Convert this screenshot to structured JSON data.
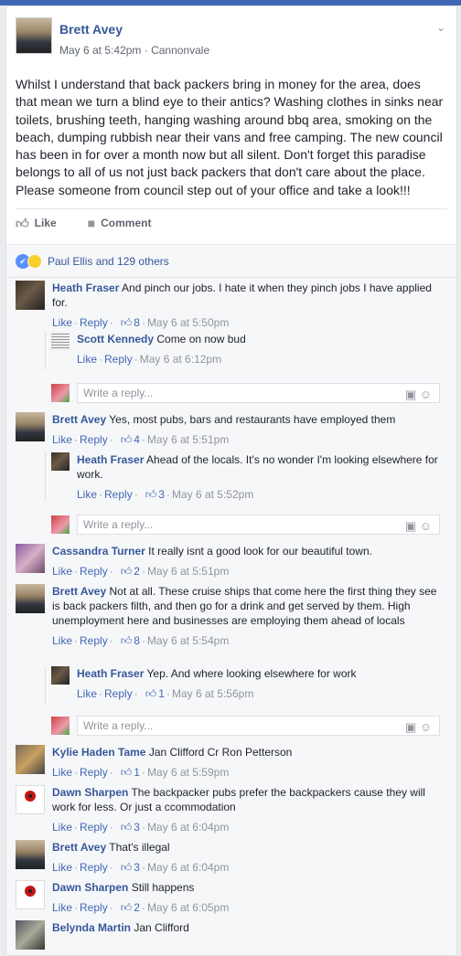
{
  "post": {
    "author": "Brett Avey",
    "date": "May 6 at 5:42pm",
    "sep": " · ",
    "location": "Cannonvale",
    "text": "Whilst I understand that back packers bring in money for the area, does that mean we turn a blind eye to their antics? Washing clothes in sinks near toilets, brushing teeth, hanging washing around bbq area, smoking on the beach, dumping rubbish near their vans and free camping. The new council has been in for over a month now but all silent. Don't forget this paradise belongs to all of us not just back packers that don't care about the place. Please someone from council step out of your office and take a look!!!",
    "like_label": "Like",
    "comment_label": "Comment",
    "likes_summary": "Paul Ellis and 129 others"
  },
  "reply_placeholder": "Write a reply...",
  "labels": {
    "like": "Like",
    "reply": "Reply",
    "dot": "·"
  },
  "comments": [
    {
      "name": "Heath Fraser",
      "text": "And pinch our jobs. I hate it when they pinch jobs I have applied for.",
      "likes": "8",
      "time": "May 6 at 5:50pm"
    },
    {
      "name": "Scott Kennedy",
      "text": "Come on now bud",
      "likes": "",
      "time": "May 6 at 6:12pm"
    },
    {
      "name": "Brett Avey",
      "text": "Yes, most pubs, bars and restaurants have employed them",
      "likes": "4",
      "time": "May 6 at 5:51pm"
    },
    {
      "name": "Heath Fraser",
      "text": "Ahead of the locals. It's no wonder I'm looking elsewhere for work.",
      "likes": "3",
      "time": "May 6 at 5:52pm"
    },
    {
      "name": "Cassandra Turner",
      "text": "It really isnt a good look for our beautiful town.",
      "likes": "2",
      "time": "May 6 at 5:51pm"
    },
    {
      "name": "Brett Avey",
      "text": "Not at all. These cruise ships that come here the first thing they see is back packers filth, and then go for a drink and get served by them. High unemployment here and businesses are employing them ahead of locals",
      "likes": "8",
      "time": "May 6 at 5:54pm"
    },
    {
      "name": "Heath Fraser",
      "text": "Yep. And where looking elsewhere for work",
      "likes": "1",
      "time": "May 6 at 5:56pm"
    },
    {
      "name": "Kylie Haden Tame",
      "text": "Jan Clifford Cr Ron Petterson",
      "likes": "1",
      "time": "May 6 at 5:59pm"
    },
    {
      "name": "Dawn Sharpen",
      "text": "The backpacker pubs prefer the backpackers cause they will work for less. Or just a ccommodation",
      "likes": "3",
      "time": "May 6 at 6:04pm"
    },
    {
      "name": "Brett Avey",
      "text": "That's illegal",
      "likes": "3",
      "time": "May 6 at 6:04pm"
    },
    {
      "name": "Dawn Sharpen",
      "text": "Still happens",
      "likes": "2",
      "time": "May 6 at 6:05pm"
    },
    {
      "name": "Belynda Martin",
      "text": "Jan Clifford",
      "likes": "",
      "time": ""
    }
  ],
  "colors": {
    "link": "#365899",
    "brand": "#4267b2",
    "muted": "#90949c"
  },
  "icons": [
    "like-thumb-icon",
    "comment-bubble-icon",
    "camera-icon",
    "emoji-icon",
    "chevron-down-icon"
  ]
}
